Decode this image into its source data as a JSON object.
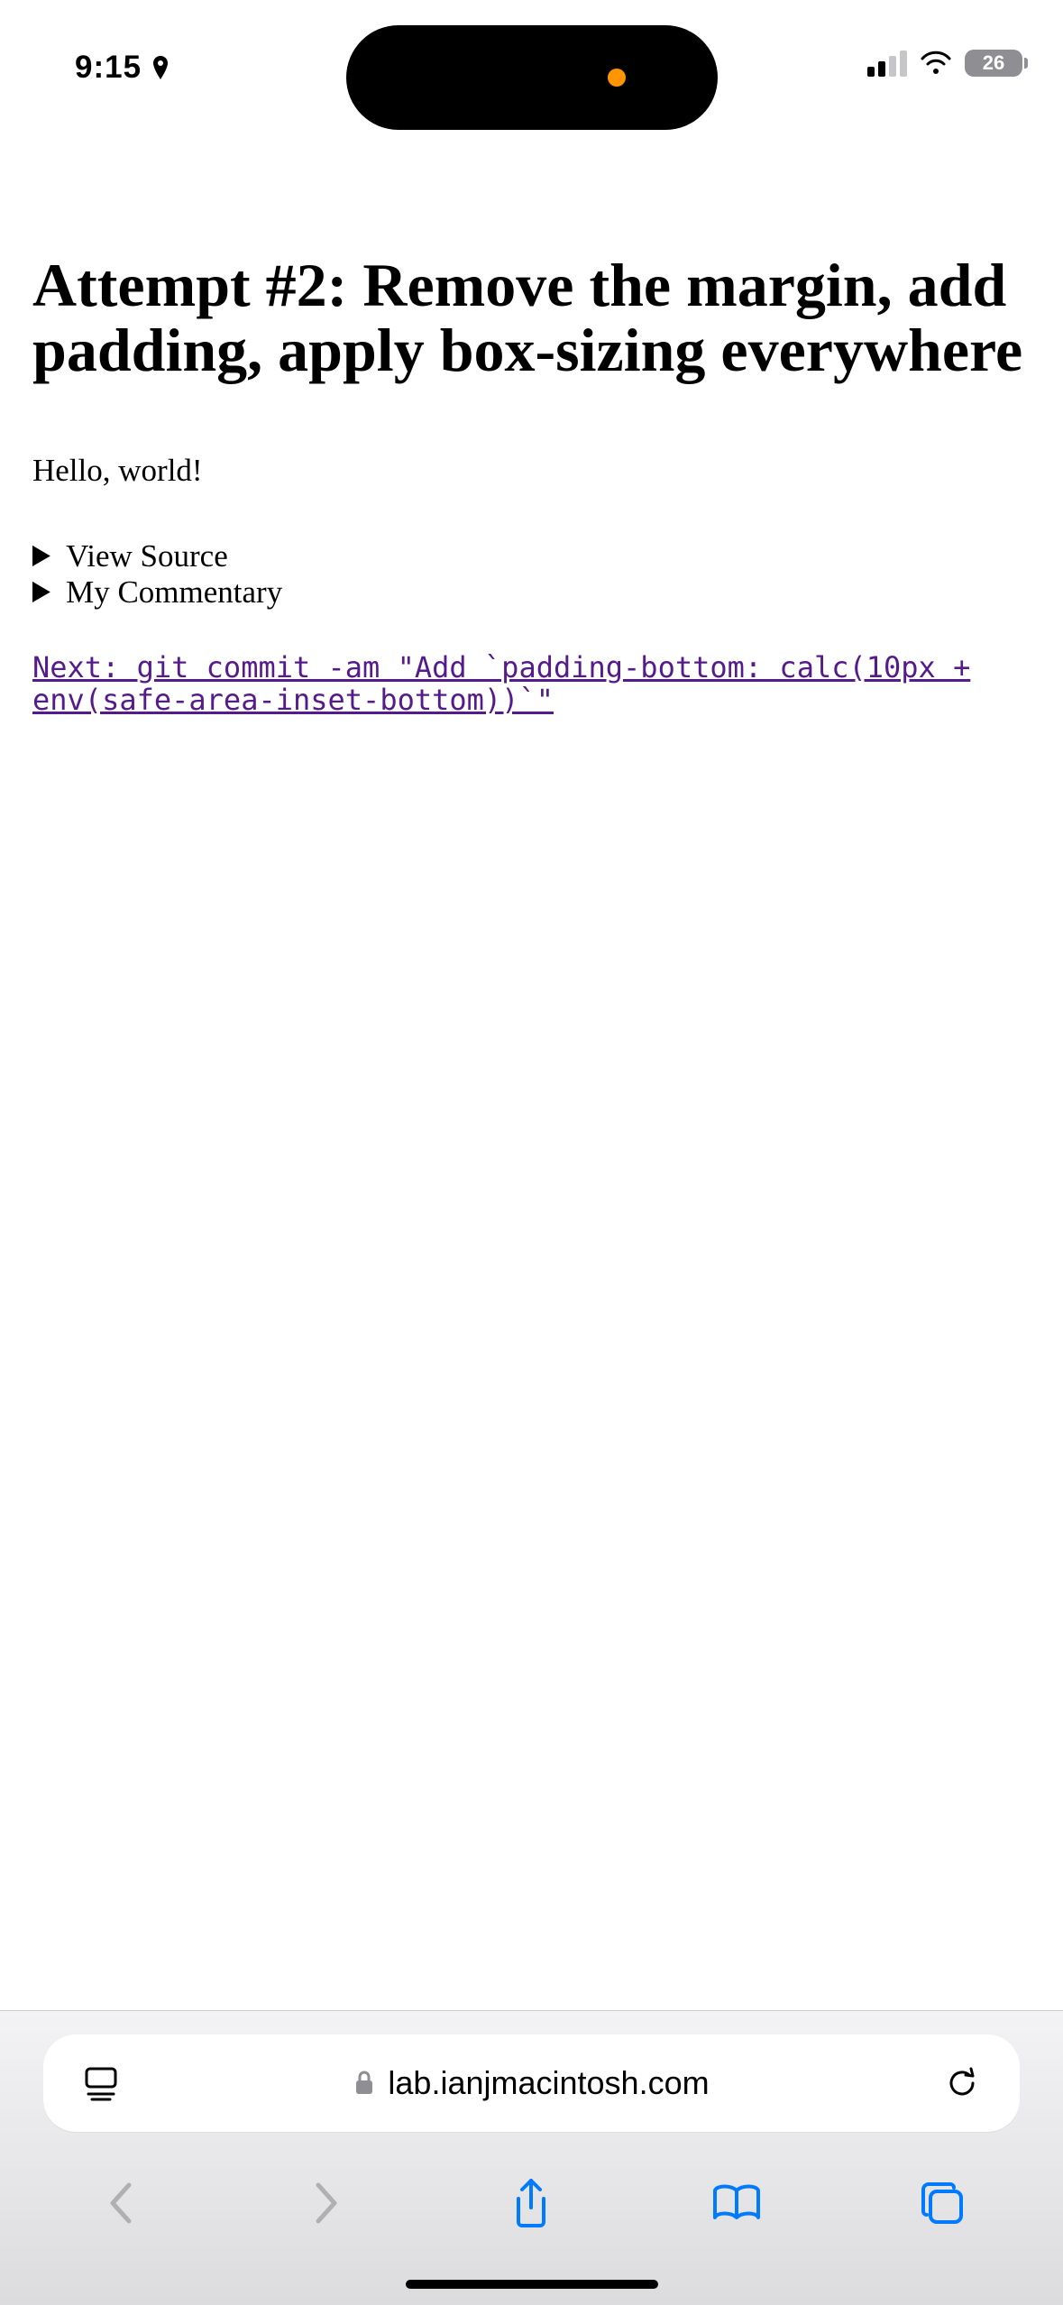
{
  "status_bar": {
    "time": "9:15",
    "battery_percent": "26"
  },
  "page": {
    "heading": "Attempt #2: Remove the margin, add padding, apply box-sizing everywhere",
    "body_text": "Hello, world!",
    "details": {
      "view_source_label": "View Source",
      "commentary_label": "My Commentary"
    },
    "next_link_text": "Next: git commit -am \"Add `padding-bottom: calc(10px + env(safe-area-inset-bottom))`\""
  },
  "browser": {
    "url": "lab.ianjmacintosh.com"
  }
}
